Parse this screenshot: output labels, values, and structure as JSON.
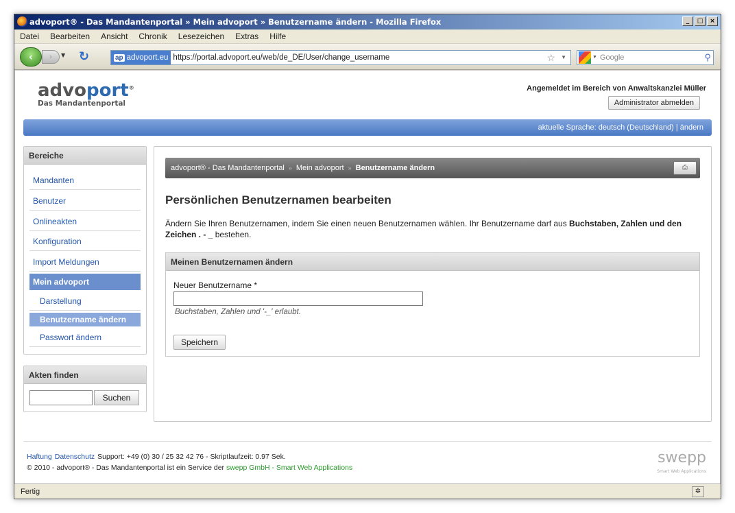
{
  "window": {
    "title": "advoport® - Das Mandantenportal  »  Mein advoport  »  Benutzername ändern - Mozilla Firefox",
    "min": "_",
    "max": "□",
    "close": "×"
  },
  "menu": [
    "Datei",
    "Bearbeiten",
    "Ansicht",
    "Chronik",
    "Lesezeichen",
    "Extras",
    "Hilfe"
  ],
  "nav": {
    "site_badge": "ap",
    "site": "advoport.eu",
    "url": "https://portal.advoport.eu/web/de_DE/User/change_username",
    "search_placeholder": "Google"
  },
  "status": {
    "text": "Fertig"
  },
  "header": {
    "logo_a": "advo",
    "logo_b": "port",
    "logo_reg": "®",
    "logo_sub": "Das Mandantenportal",
    "login_text": "Angemeldet im Bereich von Anwaltskanzlei Müller",
    "logout": "Administrator abmelden",
    "lang": "aktuelle Sprache: deutsch (Deutschland) | ändern"
  },
  "sidebar": {
    "title": "Bereiche",
    "items": [
      "Mandanten",
      "Benutzer",
      "Onlineakten",
      "Konfiguration",
      "Import Meldungen"
    ],
    "active": "Mein advoport",
    "subitems": [
      "Darstellung",
      "Benutzername ändern",
      "Passwort ändern"
    ],
    "akten_title": "Akten finden",
    "akten_btn": "Suchen"
  },
  "breadcrumb": {
    "a": "advoport® - Das Mandantenportal",
    "b": "Mein advoport",
    "c": "Benutzername ändern",
    "sep": "»"
  },
  "main": {
    "heading": "Persönlichen Benutzernamen bearbeiten",
    "intro_a": "Ändern Sie Ihren Benutzernamen, indem Sie einen neuen Benutzernamen wählen. Ihr Benutzername darf aus ",
    "intro_b": "Buchstaben, Zahlen und den Zeichen . - _",
    "intro_c": " bestehen.",
    "form_title": "Meinen Benutzernamen ändern",
    "label": "Neuer Benutzername *",
    "hint": "Buchstaben, Zahlen und '-_' erlaubt.",
    "save": "Speichern"
  },
  "footer": {
    "haftung": "Haftung",
    "datenschutz": "Datenschutz",
    "support": "Support: +49 (0) 30 / 25 32 42 76 - Skriptlaufzeit: 0.97 Sek.",
    "copy": "© 2010 - advoport® - Das Mandantenportal ist ein Service der ",
    "swepp_link": "swepp GmbH - Smart Web Applications",
    "logo": "swepp",
    "logo_sub": "Smart Web Applications"
  }
}
